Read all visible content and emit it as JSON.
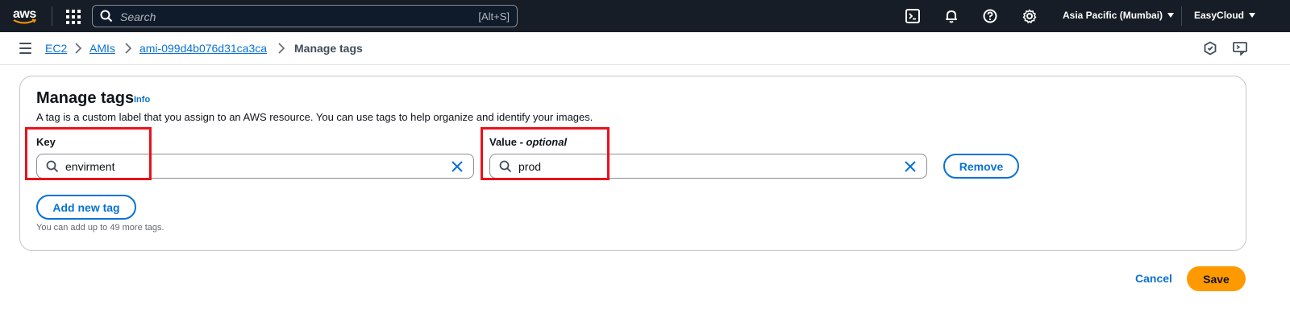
{
  "topnav": {
    "logo_text": "aws",
    "search": {
      "placeholder": "Search",
      "shortcut": "[Alt+S]"
    },
    "icons": [
      "cloudshell-icon",
      "bell-icon",
      "help-icon",
      "gear-icon"
    ],
    "region": "Asia Pacific (Mumbai)",
    "account": "EasyCloud"
  },
  "breadcrumb": {
    "items": [
      "EC2",
      "AMIs",
      "ami-099d4b076d31ca3ca"
    ],
    "current": "Manage tags"
  },
  "panel": {
    "title": "Manage tags",
    "info": "Info",
    "description": "A tag is a custom label that you assign to an AWS resource. You can use tags to help organize and identify your images.",
    "key_label": "Key",
    "value_label": "Value",
    "value_label_suffix": "optional",
    "tags": [
      {
        "key": "envirment",
        "value": "prod"
      }
    ],
    "remove_label": "Remove",
    "add_label": "Add new tag",
    "hint": "You can add up to 49 more tags."
  },
  "footer": {
    "cancel": "Cancel",
    "save": "Save"
  },
  "colors": {
    "nav_bg": "#161d26",
    "link": "#0972d3",
    "primary": "#ff9900",
    "highlight": "#e8121c"
  }
}
